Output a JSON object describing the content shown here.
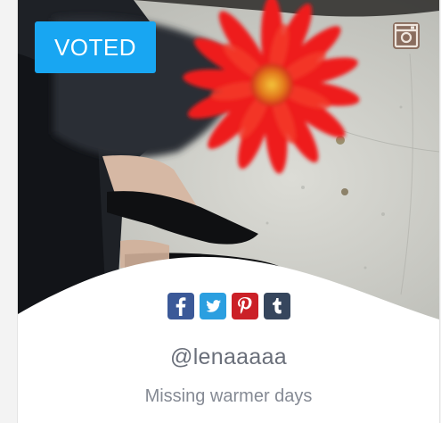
{
  "badge": {
    "label": "VOTED",
    "color": "#18a6f2"
  },
  "source_icon": "instagram-icon",
  "share": [
    {
      "network": "facebook",
      "icon": "facebook-icon",
      "color": "#3b5998"
    },
    {
      "network": "twitter",
      "icon": "twitter-icon",
      "color": "#2b9fe0"
    },
    {
      "network": "pinterest",
      "icon": "pinterest-icon",
      "color": "#cb2027"
    },
    {
      "network": "tumblr",
      "icon": "tumblr-icon",
      "color": "#36465d"
    }
  ],
  "post": {
    "username": "@lenaaaaa",
    "caption": "Missing warmer days"
  }
}
